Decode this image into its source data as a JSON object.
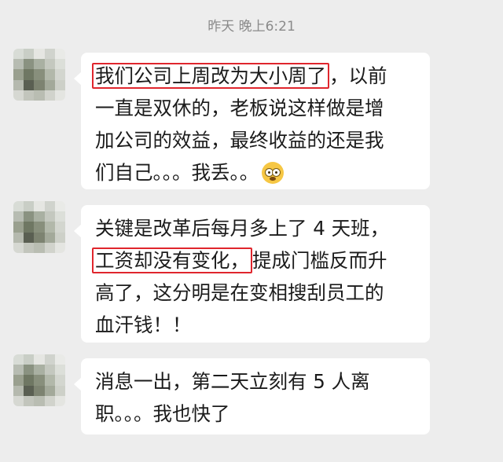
{
  "chat": {
    "timestamp": "昨天 晚上6:21",
    "messages": [
      {
        "highlight": "我们公司上周改为大小周了",
        "line1_rest": "，以前",
        "line2": "一直是双休的，老板说这样做是增",
        "line3": "加公司的效益，最终收益的还是我",
        "line4": "们自己。。。我丢。。",
        "emoji": "flushed-face-emoji"
      },
      {
        "line1": "关键是改革后每月多上了 4 天班，",
        "highlight": "工资却没有变化，",
        "line2_rest": "提成门槛反而升",
        "line3": "高了，这分明是在变相搜刮员工的",
        "line4": "血汗钱！！"
      },
      {
        "line1": "消息一出，第二天立刻有 5 人离",
        "line2": "职。。。我也快了"
      }
    ]
  }
}
